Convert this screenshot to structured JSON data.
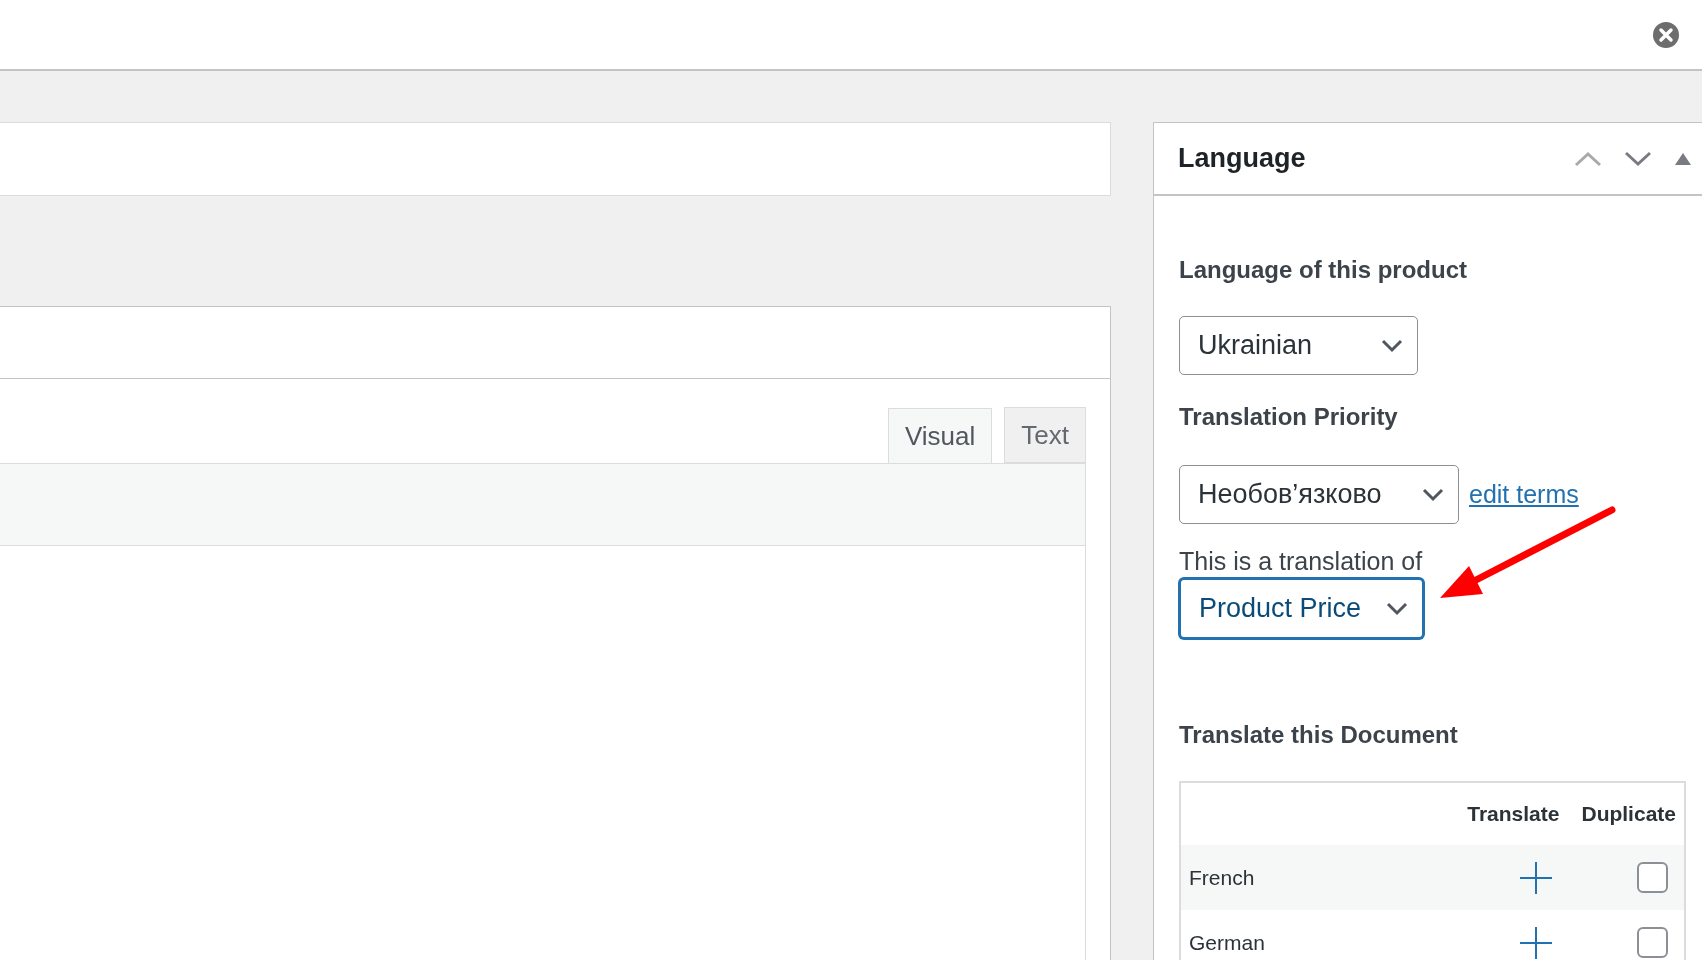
{
  "editor": {
    "tabs": [
      {
        "label": "Visual",
        "selected": true
      },
      {
        "label": "Text",
        "selected": false
      }
    ]
  },
  "language_panel": {
    "title": "Language",
    "language_label": "Language of this product",
    "language_select": {
      "value": "Ukrainian",
      "focused": false
    },
    "priority_label": "Translation Priority",
    "priority_select": {
      "value": "Необов’язково",
      "focused": false
    },
    "edit_terms_link": "edit terms",
    "translation_of_label": "This is a translation of",
    "translation_of_select": {
      "value": "Product Price",
      "focused": true
    },
    "translate_heading": "Translate this Document",
    "table": {
      "columns": [
        "Translate",
        "Duplicate"
      ],
      "rows": [
        {
          "language": "French",
          "checked": false
        },
        {
          "language": "German",
          "checked": false
        }
      ]
    }
  }
}
